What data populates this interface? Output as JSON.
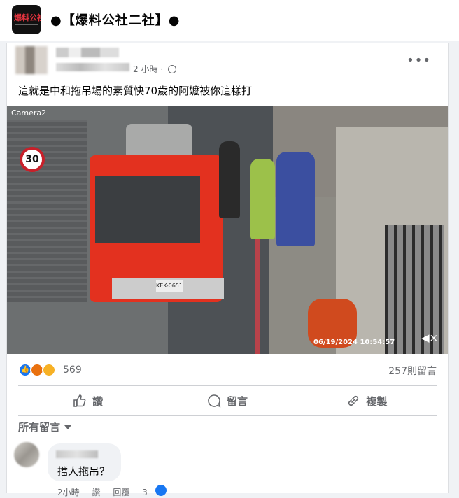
{
  "group": {
    "title": "●【爆料公社二社】●",
    "logo_text": "爆料公社"
  },
  "post": {
    "time": "2 小時 ·",
    "text": "這就是中和拖吊場的素質快70歲的阿嬤被你這樣打",
    "more": "•••"
  },
  "video": {
    "camera_label": "Camera2",
    "timestamp": "06/19/2024 10:54:57",
    "speed_sign": "30",
    "plate": "KEK-0651",
    "sound_icon": "speaker-muted-icon"
  },
  "reactions": {
    "count": "569",
    "comment_count": "257則留言",
    "icons": [
      "like-icon",
      "angry-icon",
      "haha-icon"
    ]
  },
  "actions": {
    "like": "讚",
    "comment": "留言",
    "share": "複製"
  },
  "comments": {
    "sort_label": "所有留言",
    "items": [
      {
        "text": "擋人拖吊？",
        "time": "2小時",
        "like": "讚",
        "reply": "回覆",
        "reaction_count": "3"
      }
    ]
  },
  "colors": {
    "accent": "#1877f2",
    "secondary_text": "#65676b",
    "background": "#f0f2f5"
  }
}
